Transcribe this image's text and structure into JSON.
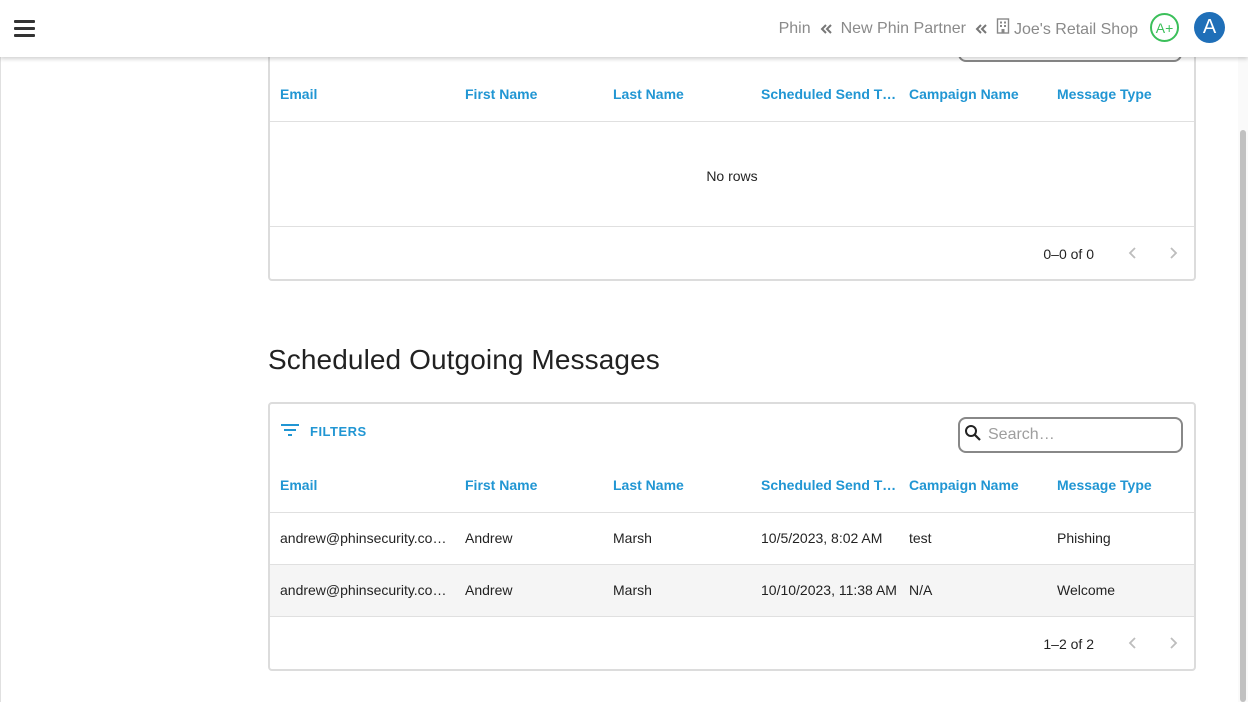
{
  "header": {
    "breadcrumbs": [
      {
        "label": "Phin"
      },
      {
        "label": "New Phin Partner"
      },
      {
        "label": "Joe's Retail Shop"
      }
    ],
    "grade": "A+",
    "avatar_letter": "A"
  },
  "columns": [
    "Email",
    "First Name",
    "Last Name",
    "Scheduled Send Ti…",
    "Campaign Name",
    "Message Type"
  ],
  "top_grid": {
    "empty_text": "No rows",
    "pagination": "0–0 of 0"
  },
  "scheduled": {
    "title": "Scheduled Outgoing Messages",
    "filters_label": "FILTERS",
    "search_placeholder": "Search…",
    "rows": [
      {
        "email": "andrew@phinsecurity.co…",
        "first": "Andrew",
        "last": "Marsh",
        "send_time": "10/5/2023, 8:02 AM",
        "campaign": "test",
        "type": "Phishing"
      },
      {
        "email": "andrew@phinsecurity.co…",
        "first": "Andrew",
        "last": "Marsh",
        "send_time": "10/10/2023, 11:38 AM",
        "campaign": "N/A",
        "type": "Welcome"
      }
    ],
    "pagination": "1–2 of 2"
  },
  "colors": {
    "accent": "#2196d3",
    "grade_green": "#3bbf5a",
    "avatar_blue": "#1f6fb8"
  }
}
